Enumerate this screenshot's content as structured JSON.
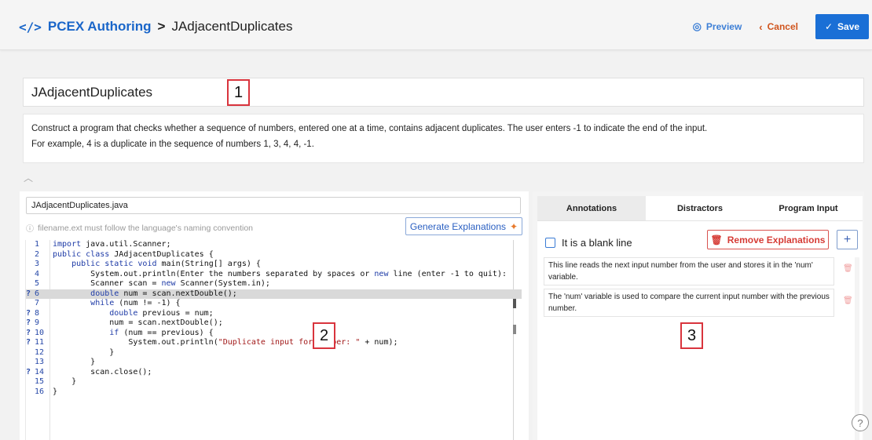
{
  "header": {
    "logo_glyph": "</>",
    "app_name": "PCEX Authoring",
    "separator": ">",
    "problem_name": "JAdjacentDuplicates",
    "preview_label": "Preview",
    "cancel_label": "Cancel",
    "save_label": "Save"
  },
  "title": {
    "value": "JAdjacentDuplicates",
    "callout": "1"
  },
  "description": {
    "line1": "Construct a program that checks whether a sequence of numbers, entered one at a time, contains adjacent duplicates. The user enters -1 to indicate the end of the input.",
    "line2": "For example, 4 is a duplicate in the sequence of numbers 1, 3, 4, 4, -1."
  },
  "editor": {
    "filename": "JAdjacentDuplicates.java",
    "hint": "filename.ext must follow the language's naming convention",
    "generate_label": "Generate Explanations",
    "callout": "2",
    "lines": [
      {
        "n": "1",
        "q": "",
        "text": "import java.util.Scanner;"
      },
      {
        "n": "2",
        "q": "",
        "text": "public class JAdjacentDuplicates {"
      },
      {
        "n": "3",
        "q": "",
        "text": "    public static void main(String[] args) {"
      },
      {
        "n": "4",
        "q": "",
        "text": "        System.out.println(\"Enter the numbers separated by spaces or new line (enter -1 to quit):"
      },
      {
        "n": "5",
        "q": "",
        "text": "        Scanner scan = new Scanner(System.in);"
      },
      {
        "n": "6",
        "q": "?",
        "text": "        double num = scan.nextDouble();",
        "highlight": true
      },
      {
        "n": "7",
        "q": "",
        "text": "        while (num != -1) {"
      },
      {
        "n": "8",
        "q": "?",
        "text": "            double previous = num;"
      },
      {
        "n": "9",
        "q": "?",
        "text": "            num = scan.nextDouble();"
      },
      {
        "n": "10",
        "q": "?",
        "text": "            if (num == previous) {"
      },
      {
        "n": "11",
        "q": "?",
        "text": "                System.out.println(\"Duplicate input for number: \" + num);"
      },
      {
        "n": "12",
        "q": "",
        "text": "            }"
      },
      {
        "n": "13",
        "q": "",
        "text": "        }"
      },
      {
        "n": "14",
        "q": "?",
        "text": "        scan.close();"
      },
      {
        "n": "15",
        "q": "",
        "text": "    }"
      },
      {
        "n": "16",
        "q": "",
        "text": "}"
      }
    ]
  },
  "right": {
    "tabs": [
      "Annotations",
      "Distractors",
      "Program Input"
    ],
    "active_tab": "Annotations",
    "blank_line_label": "It is a blank line",
    "remove_label": "Remove Explanations",
    "add_label": "+",
    "callout": "3",
    "explanations": [
      "This line reads the next input number from the user and stores it in the 'num' variable.",
      "The 'num' variable is used to compare the current input number with the previous number."
    ]
  },
  "help_label": "?",
  "colors": {
    "accent": "#1a6fd6",
    "brand": "#1a66c9",
    "cancel": "#d0551e",
    "danger": "#d63c36",
    "callout_border": "#d9343d"
  }
}
